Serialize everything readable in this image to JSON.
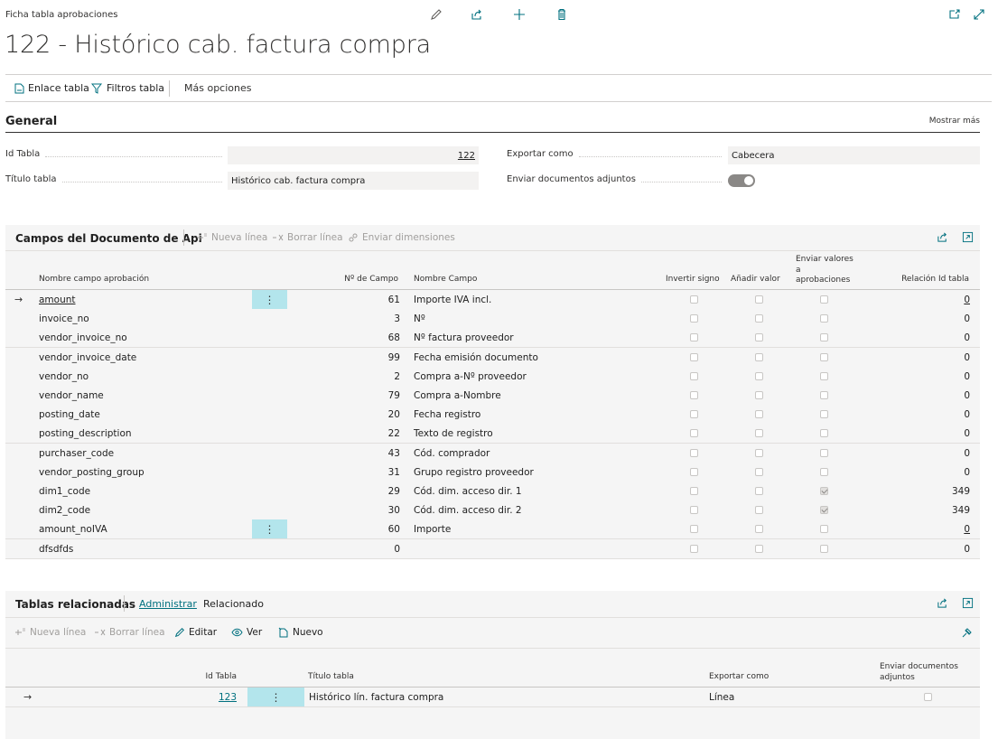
{
  "header": {
    "breadcrumb": "Ficha tabla aprobaciones",
    "title": "122 - Histórico cab. factura compra"
  },
  "actions": {
    "table_link": "Enlace tabla",
    "table_filters": "Filtros tabla",
    "more_options": "Más opciones"
  },
  "general": {
    "title": "General",
    "show_more": "Mostrar más",
    "table_id_label": "Id Tabla",
    "table_id_value": "122",
    "table_title_label": "Título tabla",
    "table_title_value": "Histórico cab. factura compra",
    "export_as_label": "Exportar como",
    "export_as_value": "Cabecera",
    "send_attachments_label": "Enviar documentos adjuntos",
    "send_attachments_value": true
  },
  "api_fields": {
    "title": "Campos del Documento de Api",
    "new_line": "Nueva línea",
    "delete_line": "Borrar línea",
    "send_dimensions": "Enviar dimensiones",
    "columns": {
      "field_name": "Nombre campo aprobación",
      "field_no": "Nº de Campo",
      "field_caption": "Nombre Campo",
      "invert_sign": "Invertir signo",
      "add_value": "Añadir valor",
      "send_values_1": "Enviar valores",
      "send_values_2": "a",
      "send_values_3": "aprobaciones",
      "relation_table_id": "Relación Id tabla"
    },
    "rows": [
      {
        "name": "amount",
        "no": "61",
        "caption": "Importe IVA incl.",
        "invert": false,
        "add": false,
        "send": false,
        "rel": "0"
      },
      {
        "name": "invoice_no",
        "no": "3",
        "caption": "Nº",
        "invert": false,
        "add": false,
        "send": false,
        "rel": "0"
      },
      {
        "name": "vendor_invoice_no",
        "no": "68",
        "caption": "Nº factura proveedor",
        "invert": false,
        "add": false,
        "send": false,
        "rel": "0"
      },
      {
        "name": "vendor_invoice_date",
        "no": "99",
        "caption": "Fecha emisión documento",
        "invert": false,
        "add": false,
        "send": false,
        "rel": "0"
      },
      {
        "name": "vendor_no",
        "no": "2",
        "caption": "Compra a-Nº proveedor",
        "invert": false,
        "add": false,
        "send": false,
        "rel": "0"
      },
      {
        "name": "vendor_name",
        "no": "79",
        "caption": "Compra a-Nombre",
        "invert": false,
        "add": false,
        "send": false,
        "rel": "0"
      },
      {
        "name": "posting_date",
        "no": "20",
        "caption": "Fecha registro",
        "invert": false,
        "add": false,
        "send": false,
        "rel": "0"
      },
      {
        "name": "posting_description",
        "no": "22",
        "caption": "Texto de registro",
        "invert": false,
        "add": false,
        "send": false,
        "rel": "0"
      },
      {
        "name": "purchaser_code",
        "no": "43",
        "caption": "Cód. comprador",
        "invert": false,
        "add": false,
        "send": false,
        "rel": "0"
      },
      {
        "name": "vendor_posting_group",
        "no": "31",
        "caption": "Grupo registro proveedor",
        "invert": false,
        "add": false,
        "send": false,
        "rel": "0"
      },
      {
        "name": "dim1_code",
        "no": "29",
        "caption": "Cód. dim. acceso dir. 1",
        "invert": false,
        "add": false,
        "send": true,
        "rel": "349"
      },
      {
        "name": "dim2_code",
        "no": "30",
        "caption": "Cód. dim. acceso dir. 2",
        "invert": false,
        "add": false,
        "send": true,
        "rel": "349"
      },
      {
        "name": "amount_noIVA",
        "no": "60",
        "caption": "Importe",
        "invert": false,
        "add": false,
        "send": false,
        "rel": "0"
      },
      {
        "name": "dfsdfds",
        "no": "0",
        "caption": "",
        "invert": false,
        "add": false,
        "send": false,
        "rel": "0"
      }
    ]
  },
  "related": {
    "title": "Tablas relacionadas",
    "tab_manage": "Administrar",
    "tab_related": "Relacionado",
    "new_line": "Nueva línea",
    "delete_line": "Borrar línea",
    "edit": "Editar",
    "view": "Ver",
    "new": "Nuevo",
    "columns": {
      "table_id": "Id Tabla",
      "table_title": "Título tabla",
      "export_as": "Exportar como",
      "send_docs_1": "Enviar documentos",
      "send_docs_2": "adjuntos"
    },
    "rows": [
      {
        "table_id": "123",
        "table_title": "Histórico lín. factura compra",
        "export_as": "Línea",
        "send_docs": false
      }
    ]
  },
  "colors": {
    "accent": "#00707f",
    "panel_bg": "#f5f5f5",
    "field_bg": "#f3f2f1",
    "selected_cell": "#b3e5ec"
  }
}
